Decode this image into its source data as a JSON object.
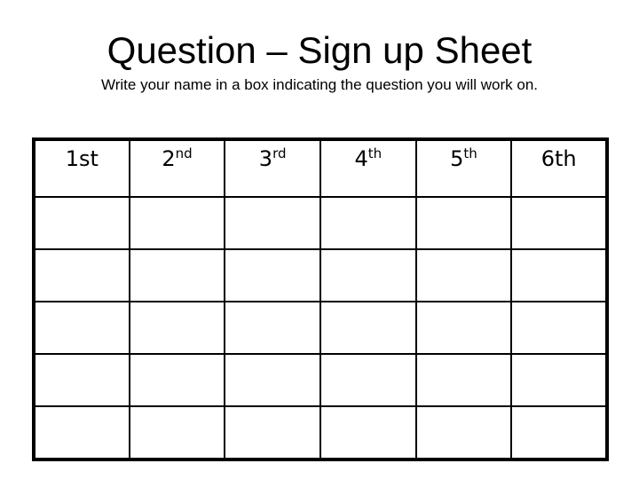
{
  "title": "Question – Sign up Sheet",
  "subtitle": "Write your name in a box indicating the question you will work on.",
  "table": {
    "headers": [
      {
        "num": "1st",
        "sup": ""
      },
      {
        "num": "2",
        "sup": "nd"
      },
      {
        "num": "3",
        "sup": "rd"
      },
      {
        "num": "4",
        "sup": "th"
      },
      {
        "num": "5",
        "sup": "th"
      },
      {
        "num": "6th",
        "sup": ""
      }
    ],
    "rows": [
      [
        "",
        "",
        "",
        "",
        "",
        ""
      ],
      [
        "",
        "",
        "",
        "",
        "",
        ""
      ],
      [
        "",
        "",
        "",
        "",
        "",
        ""
      ],
      [
        "",
        "",
        "",
        "",
        "",
        ""
      ],
      [
        "",
        "",
        "",
        "",
        "",
        ""
      ]
    ]
  }
}
